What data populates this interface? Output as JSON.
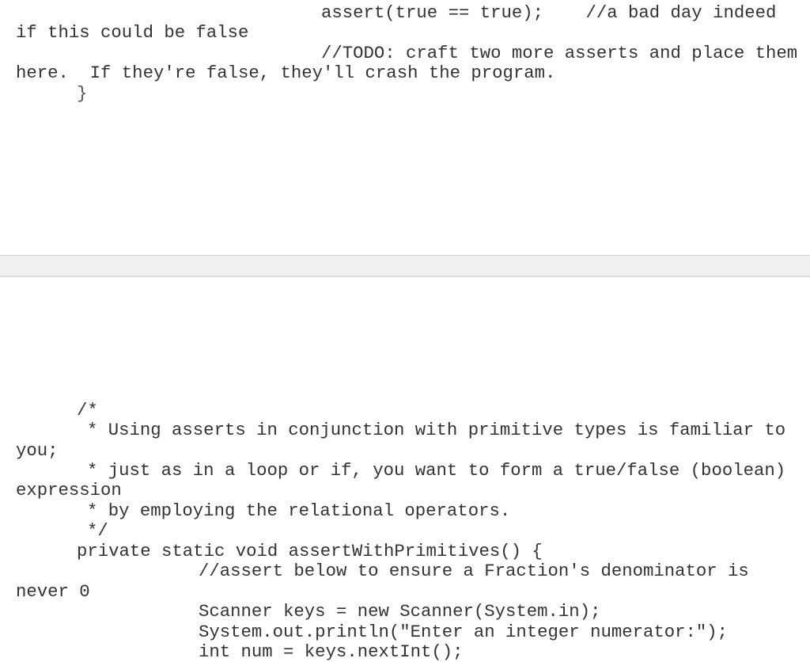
{
  "top_snippet": {
    "lines": [
      {
        "indent": "code",
        "text": "assert(true == true);    //a bad day indeed"
      },
      {
        "indent": "wrap",
        "text": "if this could be false"
      },
      {
        "indent": "code",
        "text": "//TODO: craft two more asserts and place them"
      },
      {
        "indent": "wrap",
        "text": "here.  If they're false, they'll crash the program."
      },
      {
        "indent": "method",
        "text": "}"
      }
    ]
  },
  "divider": {
    "label": ""
  },
  "bottom_snippet": {
    "lines": [
      {
        "indent": "method",
        "text": "/*"
      },
      {
        "indent": "doc",
        "text": "* Using asserts in conjunction with primitive types is familiar to"
      },
      {
        "indent": "wrap",
        "text": "you;"
      },
      {
        "indent": "doc",
        "text": "* just as in a loop or if, you want to form a true/false (boolean)"
      },
      {
        "indent": "wrap",
        "text": "expression"
      },
      {
        "indent": "doc",
        "text": "* by employing the relational operators."
      },
      {
        "indent": "doc",
        "text": "*/"
      },
      {
        "indent": "method",
        "text": "private static void assertWithPrimitives() {"
      },
      {
        "indent": "body",
        "text": "//assert below to ensure a Fraction's denominator is"
      },
      {
        "indent": "wrap",
        "text": "never 0"
      },
      {
        "indent": "body",
        "text": "Scanner keys = new Scanner(System.in);"
      },
      {
        "indent": "body",
        "text": "System.out.println(\"Enter an integer numerator:\");"
      },
      {
        "indent": "body",
        "text": "int num = keys.nextInt();"
      }
    ]
  }
}
